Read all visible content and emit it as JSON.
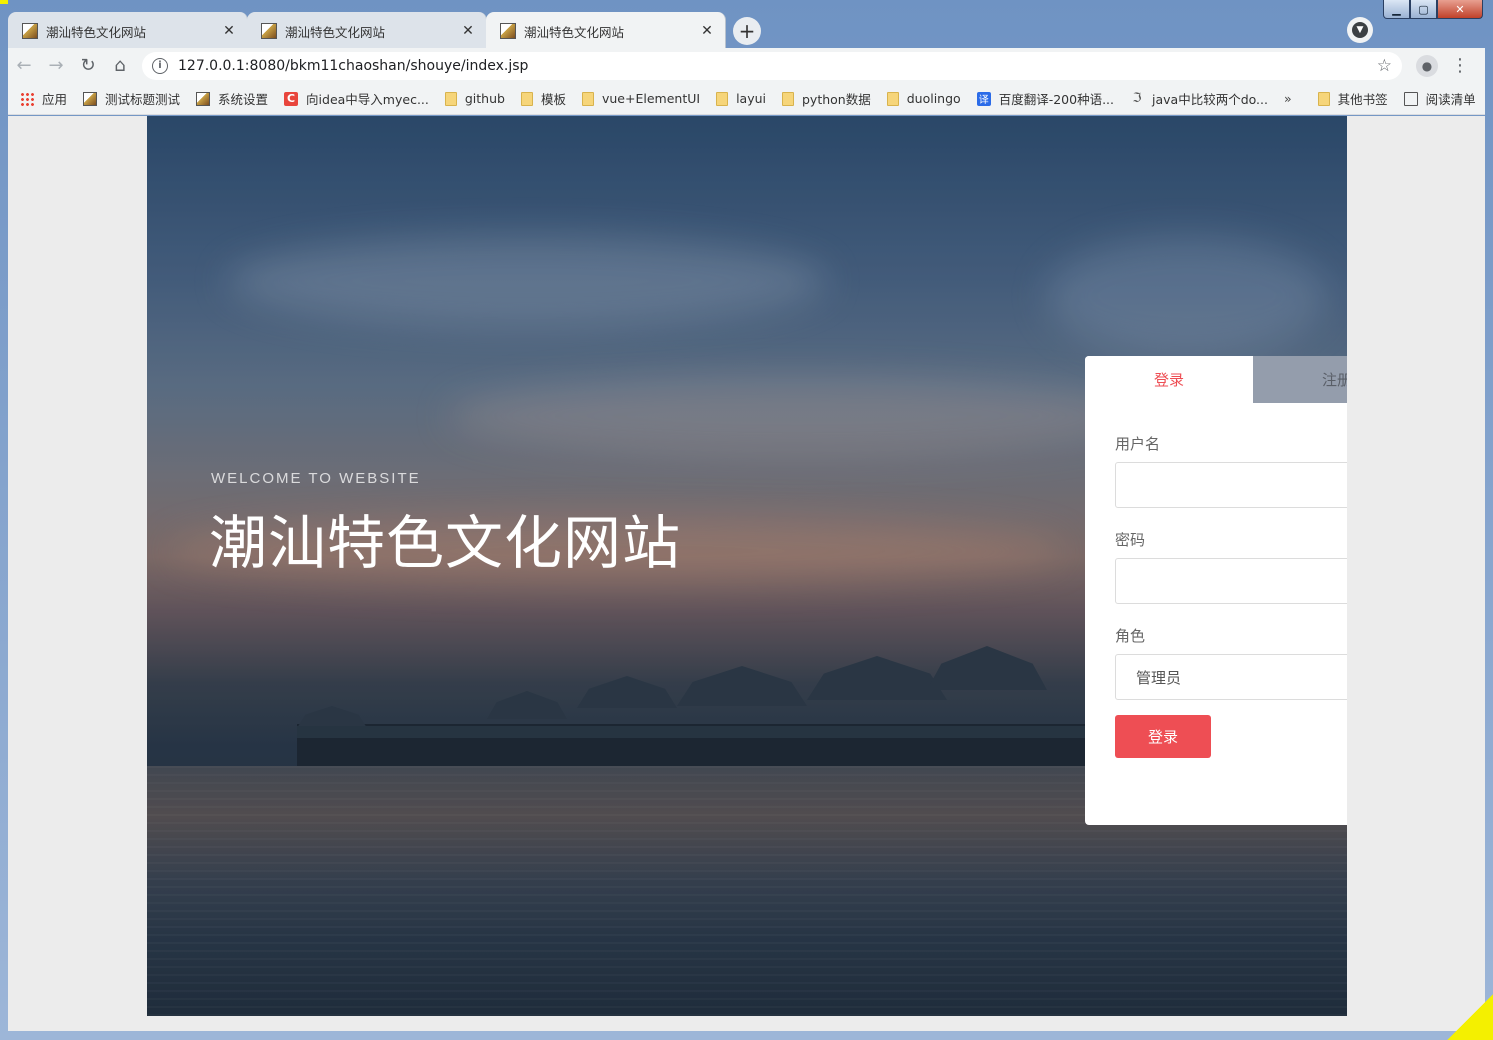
{
  "browser": {
    "tabs": [
      {
        "title": "潮汕特色文化网站",
        "active": false
      },
      {
        "title": "潮汕特色文化网站",
        "active": false
      },
      {
        "title": "潮汕特色文化网站",
        "active": true
      }
    ],
    "new_tab_label": "+",
    "address": {
      "url": "127.0.0.1:8080/bkm11chaoshan/shouye/index.jsp"
    },
    "bookmarks": [
      {
        "label": "应用",
        "icon": "apps-icon"
      },
      {
        "label": "测试标题测试",
        "icon": "site-icon"
      },
      {
        "label": "系统设置",
        "icon": "site-icon"
      },
      {
        "label": "向idea中导入myec...",
        "icon": "c-icon"
      },
      {
        "label": "github",
        "icon": "folder-icon"
      },
      {
        "label": "模板",
        "icon": "folder-icon"
      },
      {
        "label": "vue+ElementUI",
        "icon": "folder-icon"
      },
      {
        "label": "layui",
        "icon": "folder-icon"
      },
      {
        "label": "python数据",
        "icon": "folder-icon"
      },
      {
        "label": "duolingo",
        "icon": "folder-icon"
      },
      {
        "label": "百度翻译-200种语...",
        "icon": "translate-icon"
      },
      {
        "label": "java中比较两个do...",
        "icon": "java-icon"
      }
    ],
    "bookmarks_more": "»",
    "other_bookmarks": "其他书签",
    "reading_list": "阅读清单",
    "window_controls": {
      "minimize": "▁",
      "maximize": "▢",
      "close": "✕"
    }
  },
  "hero": {
    "welcome": "WELCOME TO WEBSITE",
    "title": "潮汕特色文化网站"
  },
  "login_card": {
    "tabs": {
      "login": "登录",
      "register": "注册"
    },
    "username_label": "用户名",
    "username_value": "",
    "password_label": "密码",
    "password_value": "",
    "role_label": "角色",
    "role_selected": "管理员",
    "submit_label": "登录"
  },
  "colors": {
    "accent": "#ee4e54",
    "tab_inactive_bg": "#949dac"
  }
}
